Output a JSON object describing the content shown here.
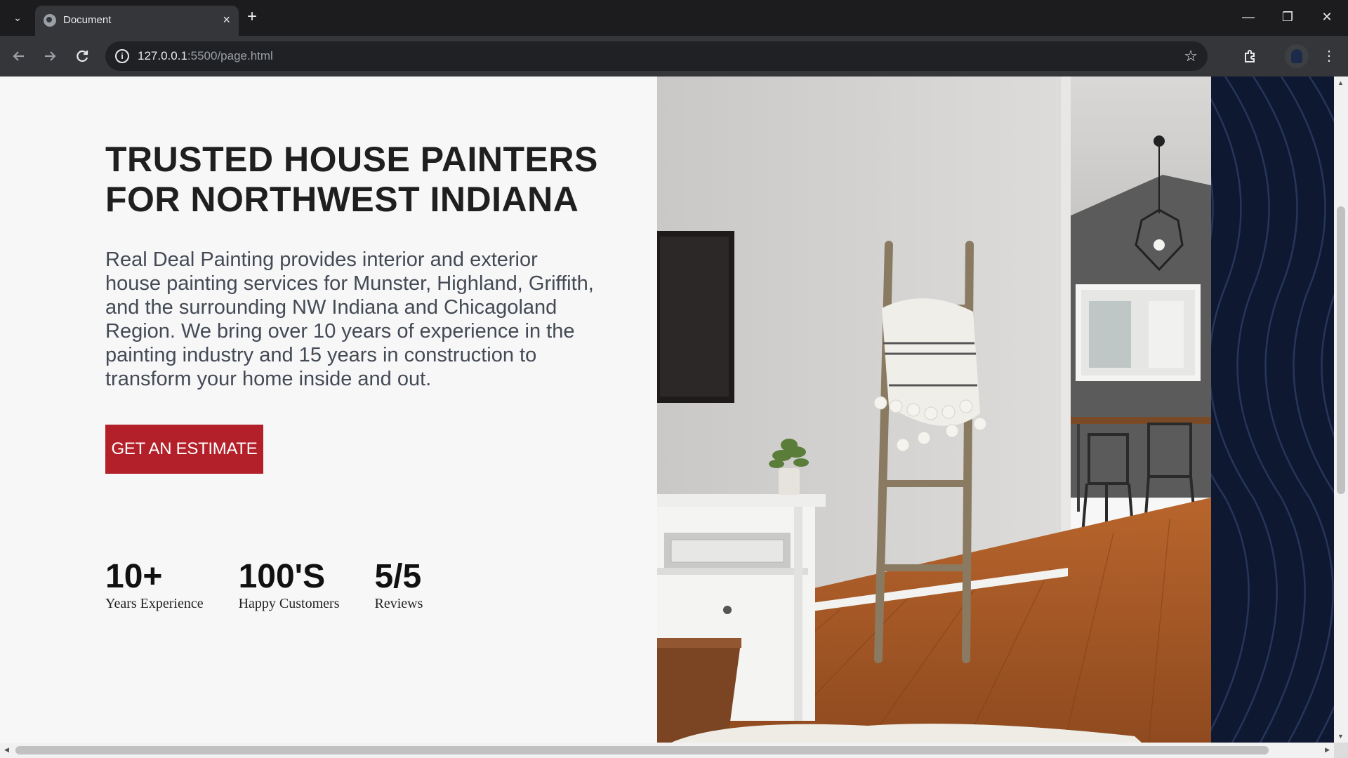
{
  "browser": {
    "tab_title": "Document",
    "tab_close": "×",
    "new_tab": "+",
    "tab_search": "⌄",
    "url_host": "127.0.0.1",
    "url_rest": ":5500/page.html",
    "window_controls": {
      "minimize": "—",
      "restore": "❐",
      "close": "✕"
    },
    "icons": [
      "back-icon",
      "forward-icon",
      "reload-icon",
      "site-info-icon",
      "bookmark-star-icon",
      "extensions-icon",
      "profile-avatar",
      "menu-icon"
    ]
  },
  "hero": {
    "headline_line1": "TRUSTED HOUSE PAINTERS",
    "headline_line2": "FOR NORTHWEST INDIANA",
    "intro": "Real Deal Painting provides interior and exterior house painting services for Munster, Highland, Griffith, and the surrounding NW Indiana and Chicagoland Region. We bring over 10 years of experience in the painting industry and 15 years in construction to transform your home inside and out.",
    "cta_label": "GET AN ESTIMATE"
  },
  "stats": [
    {
      "value": "10+",
      "label": "Years Experience"
    },
    {
      "value": "100'S",
      "label": "Happy Customers"
    },
    {
      "value": "5/5",
      "label": "Reviews"
    }
  ],
  "colors": {
    "accent_red": "#b3202a",
    "navy_panel": "#0e1830",
    "page_bg": "#f7f7f7"
  }
}
